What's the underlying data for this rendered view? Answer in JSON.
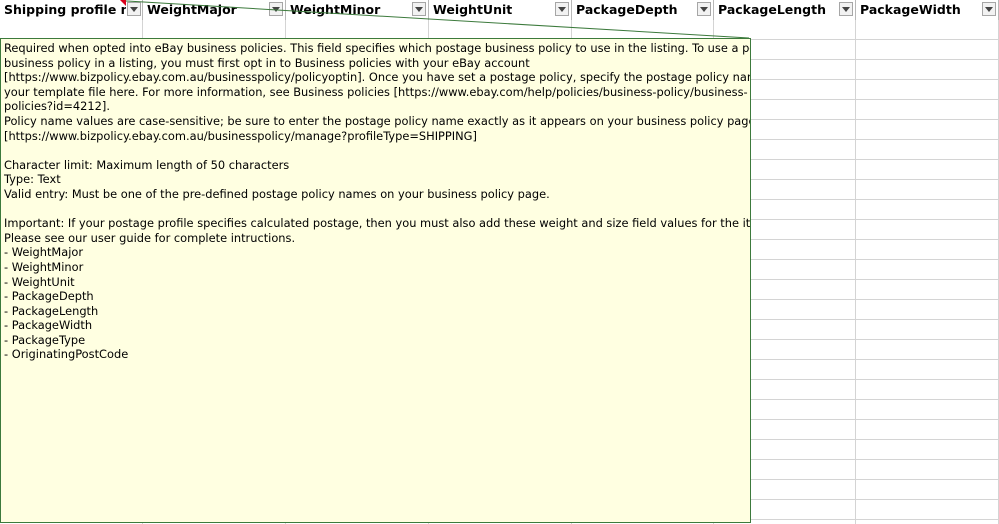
{
  "spreadsheet": {
    "columns": [
      {
        "header": "Shipping profile nam"
      },
      {
        "header": "WeightMajor"
      },
      {
        "header": "WeightMinor"
      },
      {
        "header": "WeightUnit"
      },
      {
        "header": "PackageDepth"
      },
      {
        "header": "PackageLength"
      },
      {
        "header": "PackageWidth"
      }
    ]
  },
  "comment": {
    "lines": [
      "Required when opted into eBay business policies.  This field specifies which postage business policy to use in the listing. To use a postage",
      "business policy in a listing, you must first opt in to Business policies with your eBay account",
      "[https://www.bizpolicy.ebay.com.au/businesspolicy/policyoptin]. Once you have set a postage policy, specify the postage policy name on",
      "your template file here. For more information, see Business policies [https://www.ebay.com/help/policies/business-policy/business-",
      "policies?id=4212].",
      "Policy name values are case-sensitive; be sure to enter the postage policy name exactly as it appears on your business policy page.",
      "[https://www.bizpolicy.ebay.com.au/businesspolicy/manage?profileType=SHIPPING]",
      "",
      "Character limit: Maximum length of 50 characters",
      "Type: Text",
      "Valid entry: Must be one of the pre-defined postage policy names on your business policy page.",
      "",
      "Important: If your postage profile specifies calculated postage, then you must also add these weight and size field values for the item.",
      "Please see our user guide for complete intructions.",
      "- WeightMajor",
      "- WeightMinor",
      "- WeightUnit",
      "- PackageDepth",
      "- PackageLength",
      "- PackageWidth",
      "- PackageType",
      "- OriginatingPostCode"
    ]
  }
}
